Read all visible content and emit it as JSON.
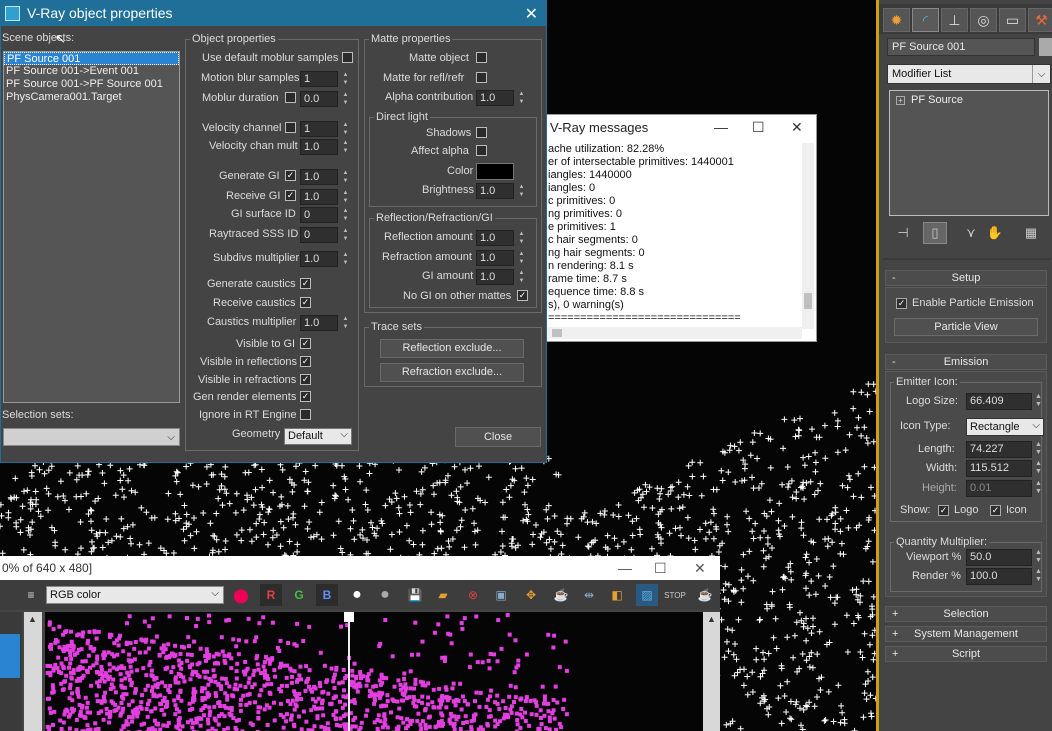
{
  "vray_dialog": {
    "title": "V-Ray object properties",
    "close_symbol": "✕",
    "scene_objects_label": "Scene objects:",
    "scene_objects": [
      "PF Source 001",
      "PF Source 001->Event 001",
      "PF Source 001->PF Source 001",
      "PhysCamera001.Target"
    ],
    "selection_sets_label": "Selection sets:",
    "object_properties": {
      "group_title": "Object properties",
      "use_default_moblur": "Use default moblur samples",
      "motion_blur_samples": "Motion blur samples",
      "motion_blur_samples_value": "1",
      "moblur_duration": "Moblur duration",
      "moblur_duration_value": "0.0",
      "velocity_channel": "Velocity channel",
      "velocity_channel_value": "1",
      "velocity_chan_mult": "Velocity chan mult",
      "velocity_chan_mult_value": "1.0",
      "generate_gi": "Generate GI",
      "generate_gi_value": "1.0",
      "receive_gi": "Receive GI",
      "receive_gi_value": "1.0",
      "gi_surface_id": "GI surface ID",
      "gi_surface_id_value": "0",
      "raytraced_sss_id": "Raytraced SSS ID",
      "raytraced_sss_id_value": "0",
      "subdivs_multiplier": "Subdivs multiplier",
      "subdivs_multiplier_value": "1.0",
      "generate_caustics": "Generate caustics",
      "receive_caustics": "Receive caustics",
      "caustics_multiplier": "Caustics multiplier",
      "caustics_multiplier_value": "1.0",
      "visible_to_gi": "Visible to GI",
      "visible_in_reflections": "Visible in reflections",
      "visible_in_refractions": "Visible in refractions",
      "gen_render_elements": "Gen render elements",
      "ignore_in_rt_engine": "Ignore in RT Engine",
      "geometry": "Geometry",
      "geometry_value": "Default"
    },
    "matte_properties": {
      "group_title": "Matte properties",
      "matte_object": "Matte object",
      "matte_for_refl": "Matte for refl/refr",
      "alpha_contribution": "Alpha contribution",
      "alpha_contribution_value": "1.0",
      "direct_light_title": "Direct light",
      "shadows": "Shadows",
      "affect_alpha": "Affect alpha",
      "color": "Color",
      "brightness": "Brightness",
      "brightness_value": "1.0",
      "rrgi_title": "Reflection/Refraction/GI",
      "reflection_amount": "Reflection amount",
      "reflection_amount_value": "1.0",
      "refraction_amount": "Refraction amount",
      "refraction_amount_value": "1.0",
      "gi_amount": "GI amount",
      "gi_amount_value": "1.0",
      "no_gi_other_mattes": "No GI on other mattes"
    },
    "trace_sets": {
      "group_title": "Trace sets",
      "reflection_exclude": "Reflection exclude...",
      "refraction_exclude": "Refraction exclude..."
    },
    "close_button": "Close"
  },
  "vray_messages": {
    "title": "V-Ray messages",
    "lines": [
      "ache utilization: 82.28%",
      "er of intersectable primitives: 1440001",
      "iangles: 1440000",
      "iangles: 0",
      "c primitives: 0",
      "ng primitives: 0",
      "e primitives: 1",
      "c hair segments: 0",
      "ng hair segments: 0",
      "n rendering: 8.1 s",
      "rame time: 8.7 s",
      "equence time: 8.8 s",
      "s), 0 warning(s)",
      "=============================="
    ]
  },
  "vfb": {
    "title": "0% of 640 x 480]",
    "channel": "RGB color",
    "r": "R",
    "g": "G",
    "b": "B"
  },
  "command_panel": {
    "object_name": "PF Source 001",
    "modifier_list": "Modifier List",
    "stack_item": "PF Source",
    "setup": {
      "title": "Setup",
      "enable_particle_emission": "Enable Particle Emission",
      "particle_view": "Particle View"
    },
    "emission": {
      "title": "Emission",
      "emitter_icon": "Emitter Icon:",
      "logo_size_label": "Logo Size:",
      "logo_size": "66.409",
      "icon_type_label": "Icon Type:",
      "icon_type": "Rectangle",
      "length_label": "Length:",
      "length": "74.227",
      "width_label": "Width:",
      "width": "115.512",
      "height_label": "Height:",
      "height": "0.01",
      "show_label": "Show:",
      "logo": "Logo",
      "icon": "Icon",
      "quantity_multiplier": "Quantity Multiplier:",
      "viewport_label": "Viewport %",
      "viewport": "50.0",
      "render_label": "Render %",
      "render": "100.0"
    },
    "rollouts": [
      "Selection",
      "System Management",
      "Script"
    ]
  },
  "colors": {
    "title_blue": "#1f6f99",
    "selection_blue": "#2a84d2",
    "magenta": "#e23ee0",
    "viewport_border": "#c9a01a"
  }
}
